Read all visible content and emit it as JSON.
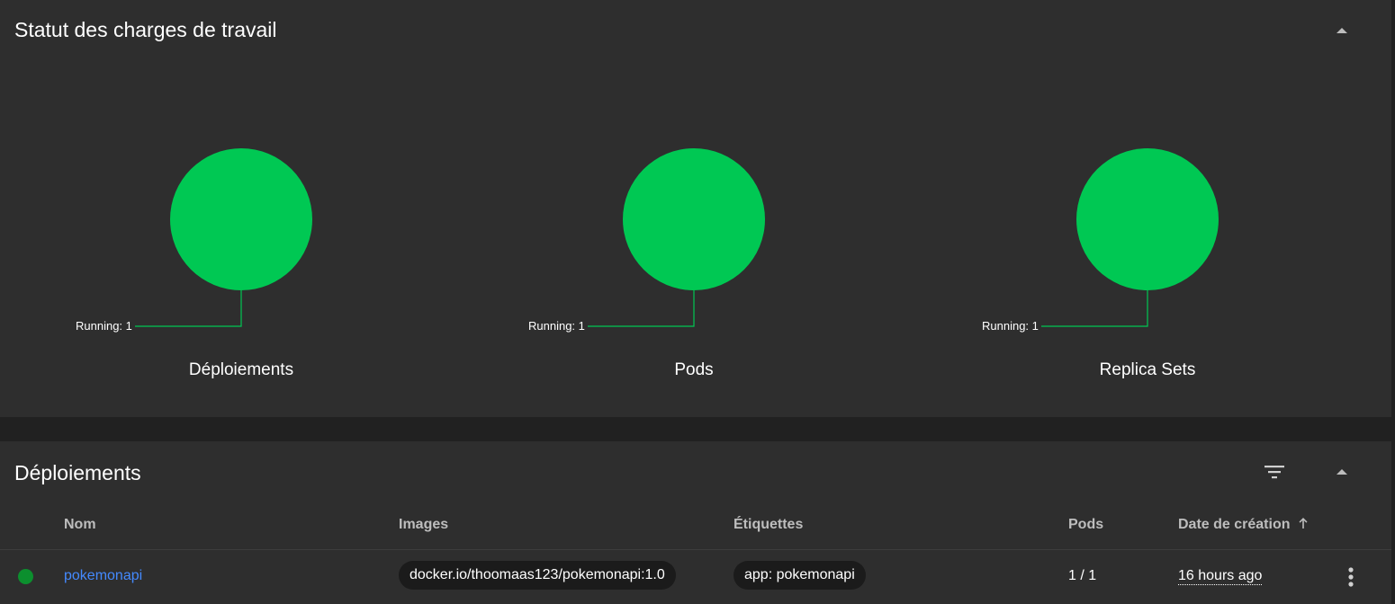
{
  "status_card": {
    "title": "Statut des charges de travail",
    "charts": [
      {
        "label": "Déploiements",
        "legend": "Running: 1",
        "running": 1
      },
      {
        "label": "Pods",
        "legend": "Running: 1",
        "running": 1
      },
      {
        "label": "Replica Sets",
        "legend": "Running: 1",
        "running": 1
      }
    ],
    "running_color": "#00c853",
    "collapse_icon": "chevron-up-icon"
  },
  "deployments": {
    "title": "Déploiements",
    "filter_icon": "filter-icon",
    "collapse_icon": "chevron-up-icon",
    "columns": {
      "name": "Nom",
      "images": "Images",
      "labels": "Étiquettes",
      "pods": "Pods",
      "created": "Date de création"
    },
    "sort_icon": "arrow-up-icon",
    "rows": [
      {
        "status": "running",
        "name": "pokemonapi",
        "image": "docker.io/thoomaas123/pokemonapi:1.0",
        "label": "app: pokemonapi",
        "pods": "1 / 1",
        "created": "16 hours ago",
        "menu_icon": "more-vert-icon"
      }
    ]
  }
}
